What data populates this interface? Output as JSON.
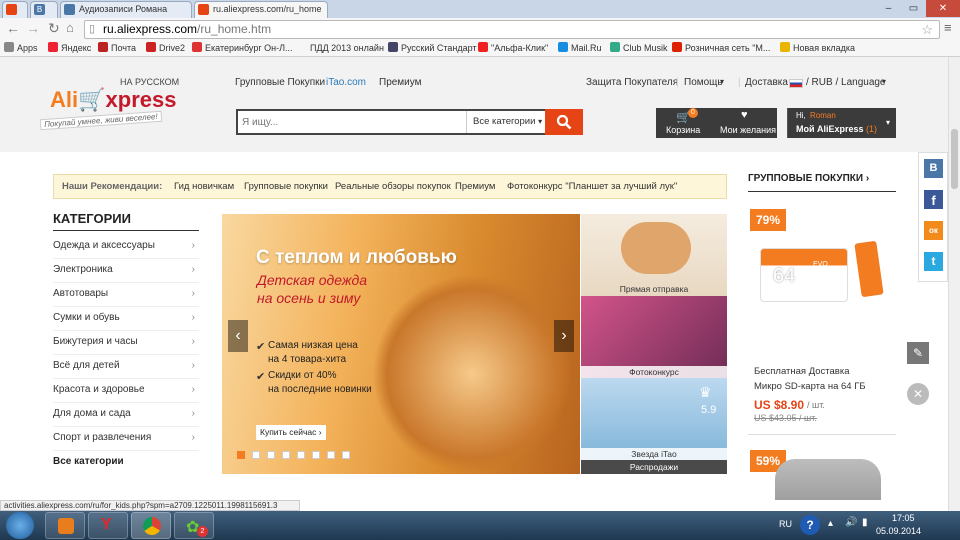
{
  "browser": {
    "tabs": [
      {
        "label": ""
      },
      {
        "label": ""
      },
      {
        "label": "Аудиозаписи Романа"
      },
      {
        "label": "ru.aliexpress.com/ru_home"
      }
    ],
    "url_domain": "ru.aliexpress.com",
    "url_path": "/ru_home.htm",
    "bookmarks": [
      "Apps",
      "Яндекс",
      "Почта",
      "Drive2",
      "Екатеринбург Он-Л...",
      "ПДД 2013 онлайн",
      "Русский Стандарт",
      "\"Альфа-Клик\"",
      "Mail.Ru",
      "Club Musik",
      "Розничная сеть \"М...",
      "Новая вкладка"
    ],
    "status_url": "activities.aliexpress.com/ru/for_kids.php?spm=a2709.1225011.1998115691.3"
  },
  "header": {
    "logo_sub": "НА РУССКОМ",
    "logo_ali": "Ali",
    "logo_express": "xpress",
    "slogan": "Покупай умнее, живи веселее!",
    "top_nav": [
      "Групповые Покупки",
      "iTao.com",
      "Премиум"
    ],
    "protection": "Защита Покупателя",
    "help": "Помощь",
    "delivery": "Доставка в",
    "currency_lang": "/ RUB / Language",
    "search_placeholder": "Я ищу...",
    "category_select": "Все категории",
    "cart_label": "Корзина",
    "cart_count": "0",
    "wishlist_label": "Мои желания",
    "greeting": "Hi,",
    "user_name": "Roman",
    "my_ali": "Мой AliExpress",
    "my_ali_count": "(1)"
  },
  "recommendations": {
    "title": "Наши Рекомендации:",
    "links": [
      "Гид новичкам",
      "Групповые покупки",
      "Реальные обзоры покупок",
      "Премиум",
      "Фотоконкурс \"Планшет за лучший лук\""
    ]
  },
  "categories": {
    "title": "КАТЕГОРИИ",
    "items": [
      "Одежда и аксессуары",
      "Электроника",
      "Автотовары",
      "Сумки и обувь",
      "Бижутерия и часы",
      "Всё для детей",
      "Красота и здоровье",
      "Для дома и сада",
      "Спорт и развлечения"
    ],
    "all": "Все категории",
    "arrow": "›"
  },
  "banner": {
    "title": "С теплом и любовью",
    "subtitle_1": "Детская одежда",
    "subtitle_2": "на осень и зиму",
    "bullet_1a": "Самая низкая цена",
    "bullet_1b": "на 4 товара-хита",
    "bullet_2a": "Скидки от 40%",
    "bullet_2b": "на последние новинки",
    "cta": "Купить сейчас ›",
    "slide_count": 8,
    "active_slide": 1
  },
  "side_tiles": [
    {
      "label": "Прямая отправка"
    },
    {
      "label": "Фотоконкурс"
    },
    {
      "label": "Звезда iTao",
      "badge": "5.9"
    },
    {
      "label": "Распродажи"
    }
  ],
  "group_buy": {
    "title": "ГРУППОВЫЕ ПОКУПКИ",
    "discount_1": "79%",
    "card_text": "64",
    "card_evo": "EVO",
    "free_shipping": "Бесплатная Доставка",
    "product_name": "Микро SD-карта на 64 ГБ",
    "price": "US $8.90",
    "price_unit": "/ шт.",
    "old_price": "US $43.05 / шт.",
    "discount_2": "59%"
  },
  "social": [
    "В",
    "f",
    "ок",
    "t"
  ],
  "taskbar": {
    "lang": "RU",
    "time": "17:05",
    "date": "05.09.2014",
    "badge": "2"
  },
  "colors": {
    "ali_orange": "#e64415",
    "ali_red": "#c3192a",
    "discount_orange": "#f47c20",
    "price_red": "#e64415"
  }
}
